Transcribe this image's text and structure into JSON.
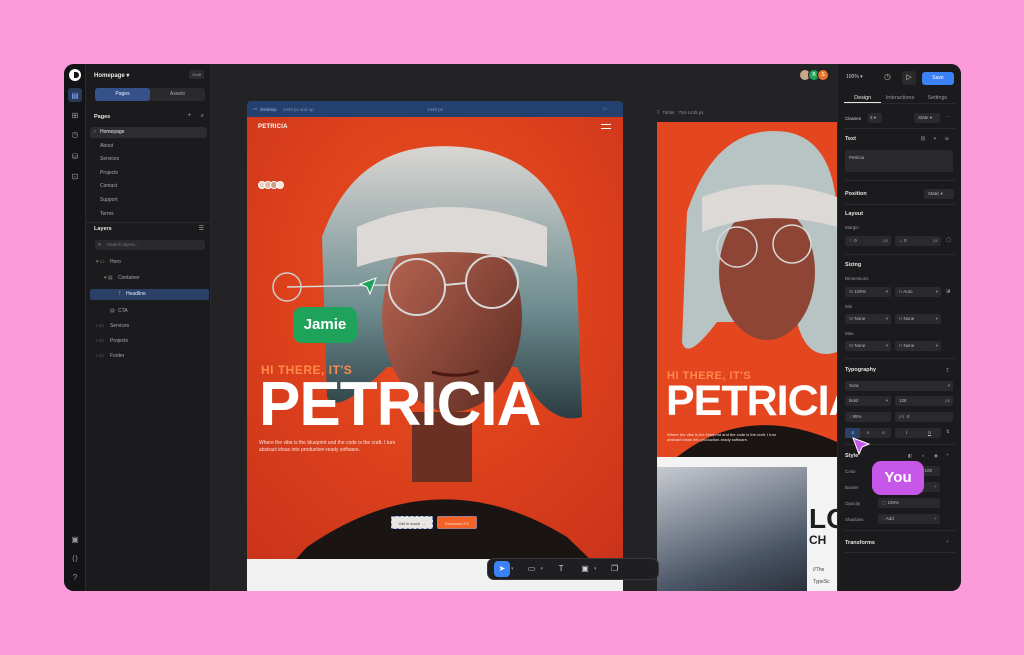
{
  "project": {
    "name": "Homepage ▾",
    "status_badge": "Draft"
  },
  "left_tabs": [
    "Pages",
    "Assets"
  ],
  "pages": {
    "title": "Pages",
    "items": [
      "Homepage",
      "About",
      "Services",
      "Projects",
      "Contact",
      "Support",
      "Terms"
    ],
    "active": "Homepage"
  },
  "layers": {
    "title": "Layers",
    "search_placeholder": "Search layers...",
    "items": [
      {
        "label": "Hero",
        "glyph": "▾ ▭"
      },
      {
        "label": "Container",
        "glyph": "▾ ▤"
      },
      {
        "label": "Headline",
        "glyph": "T"
      },
      {
        "label": "CTA",
        "glyph": "▤"
      },
      {
        "label": "Services",
        "glyph": "› ▭"
      },
      {
        "label": "Projects",
        "glyph": "› ▭"
      },
      {
        "label": "Footer",
        "glyph": "› ▭"
      }
    ]
  },
  "canvas": {
    "desktop_frame": {
      "label": "Desktop",
      "meta": "1440 px and up",
      "width": "1440 px"
    },
    "tablet_frame": {
      "label": "Tablet",
      "meta": "768-1439 px"
    },
    "site": {
      "brand": "PETRICIA",
      "greeting": "HI THERE, IT'S",
      "name": "PETRICIA",
      "tagline_line1": "Where the vibe is the blueprint and the code is the craft. I turn",
      "tagline_line2": "abstract ideas into production-ready software.",
      "cta_primary": "Get in touch →",
      "cta_secondary": "Download CV",
      "next_section_partial": "LO",
      "next_section_partial2": "CH",
      "next_text_1": "//The",
      "next_text_2": "TypeSc"
    },
    "collaborators": {
      "jamie": "Jamie",
      "you": "You"
    }
  },
  "toolbar": {
    "tools": [
      "cursor-tool",
      "frame-tool",
      "text-tool",
      "image-tool",
      "components-tool"
    ]
  },
  "right_panel": {
    "zoom": "100% ▾",
    "save_label": "Save",
    "tabs": [
      "Design",
      "Interactions",
      "Settings"
    ],
    "classes": {
      "label": "Classes",
      "count": "3 ▾",
      "state": "State ▾"
    },
    "text": {
      "title": "Text",
      "value": "Petricia"
    },
    "position": {
      "title": "Position",
      "value": "Static ▾"
    },
    "layout": {
      "title": "Layout",
      "margin_label": "Margin",
      "margin_top": "0",
      "margin_bottom": "0",
      "unit": "px"
    },
    "sizing": {
      "title": "Sizing",
      "dimensions_label": "Dimensions",
      "w": "100%",
      "h": "Auto",
      "min_label": "Min",
      "min_w": "None",
      "min_h": "None",
      "max_label": "Max",
      "max_w": "None",
      "max_h": "None"
    },
    "typography": {
      "title": "Typography",
      "font": "Sora",
      "weight": "Bold",
      "size": "128",
      "line_height": "95%",
      "letter_spacing": "-2",
      "unit": "px"
    },
    "style": {
      "title": "Style",
      "color_label": "Color",
      "color_value": "100",
      "border_label": "Border",
      "opacity_label": "Opacity",
      "opacity_value": "100%",
      "shadows_label": "Shadows",
      "shadows_value": "Add"
    },
    "transforms": {
      "title": "Transforms"
    }
  },
  "colors": {
    "accent": "#3b82f6",
    "hero_bg": "#e8441e",
    "jamie": "#1fa35b",
    "you": "#c657e8"
  }
}
